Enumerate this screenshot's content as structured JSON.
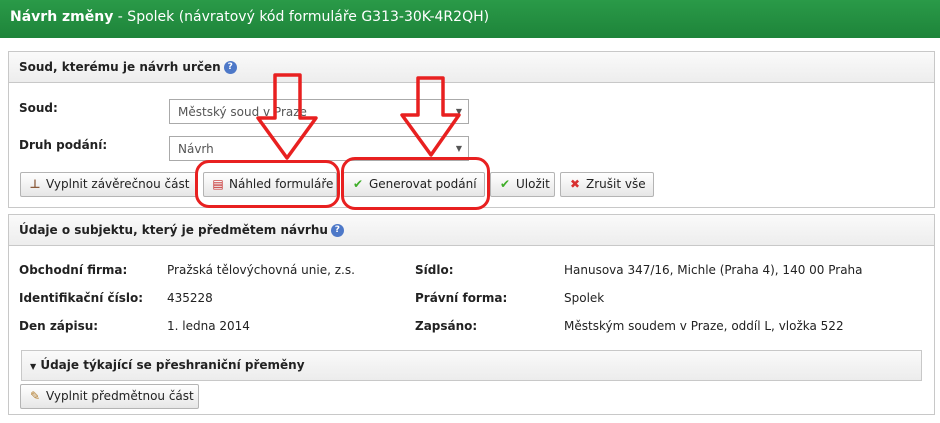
{
  "header": {
    "title_bold": "Návrh změny",
    "title_rest": " - Spolek (návratový kód formuláře G313-30K-4R2QH)"
  },
  "court_panel": {
    "heading": "Soud, kterému je návrh určen",
    "help_icon": "?",
    "court_label": "Soud:",
    "court_value": "Městský soud v Praze",
    "filing_label": "Druh podání:",
    "filing_value": "Návrh",
    "buttons": {
      "fill_final": "Vyplnit závěrečnou část",
      "preview": "Náhled formuláře",
      "generate": "Generovat podání",
      "save": "Uložit",
      "cancel_all": "Zrušit vše"
    }
  },
  "subject_panel": {
    "heading": "Údaje o subjektu, který je předmětem návrhu",
    "help_icon": "?",
    "fields": {
      "firm_label": "Obchodní firma:",
      "firm_value": "Pražská tělovýchovná unie, z.s.",
      "id_label": "Identifikační číslo:",
      "id_value": "435228",
      "date_label": "Den zápisu:",
      "date_value": "1. ledna 2014",
      "seat_label": "Sídlo:",
      "seat_value": "Hanusova 347/16, Michle (Praha 4), 140 00 Praha",
      "form_label": "Právní forma:",
      "form_value": "Spolek",
      "reg_label": "Zapsáno:",
      "reg_value": "Městským soudem v Praze, oddíl L, vložka 522"
    },
    "crossborder_heading": "Údaje týkající se přeshraniční přeměny",
    "fill_subject_button": "Vyplnit předmětnou část"
  },
  "colors": {
    "header_green": "#1e843a",
    "annotation_red": "#e82020",
    "help_blue": "#4d78c8"
  },
  "icons": [
    "stamp-icon",
    "pdf-icon",
    "checkmark-icon",
    "red-x-icon",
    "pencil-icon",
    "help-icon",
    "down-arrow-icon",
    "triangle-down-icon"
  ]
}
